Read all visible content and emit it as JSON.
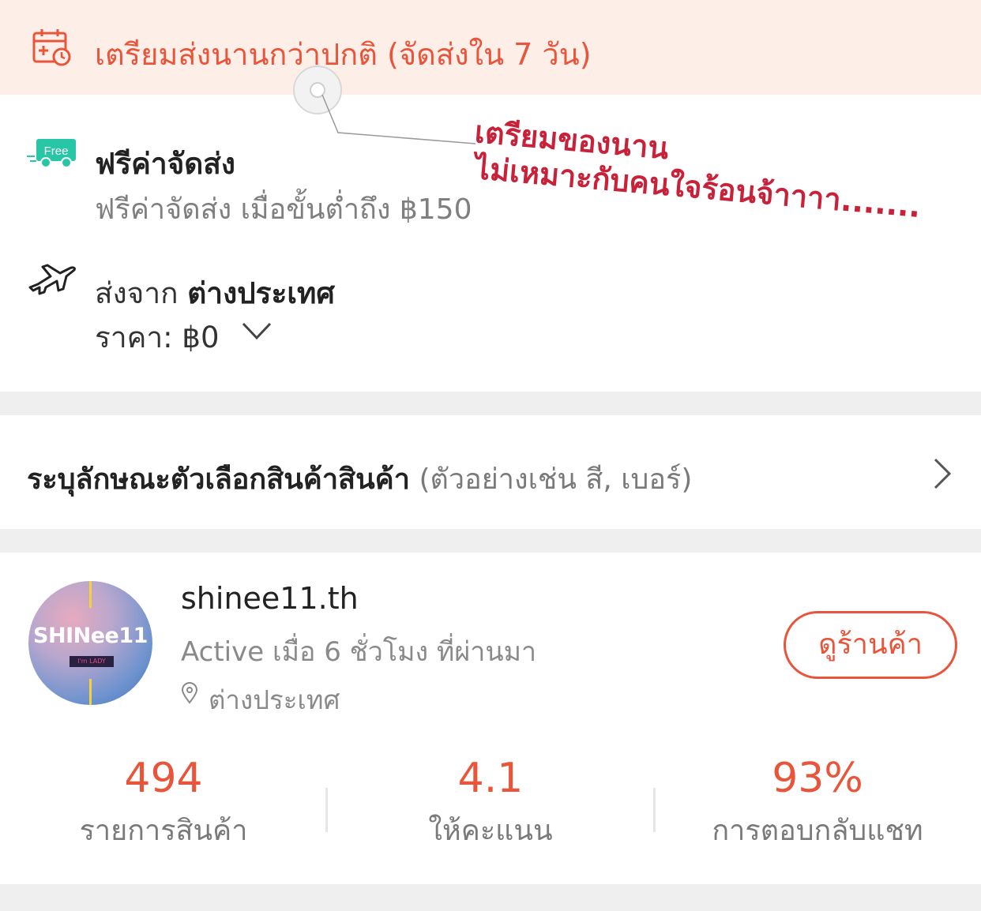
{
  "banner": {
    "text": "เตรียมส่งนานกว่าปกติ (จัดส่งใน 7 วัน)",
    "icon": "calendar-icon"
  },
  "shipping": {
    "free_badge": "Free",
    "free_title": "ฟรีค่าจัดส่ง",
    "free_subtitle": "ฟรีค่าจัดส่ง เมื่อขั้นต่ำถึง ฿150",
    "from_label": "ส่งจาก",
    "from_value": "ต่างประเทศ",
    "price_label": "ราคา: ฿0"
  },
  "annotation": {
    "line1": "เตรียมของนาน",
    "line2": "ไม่เหมาะกับคนใจร้อนจ้าาาา......."
  },
  "variant": {
    "title": "ระบุลักษณะตัวเลือกสินค้าสินค้า",
    "hint": "(ตัวอย่างเช่น สี, เบอร์)"
  },
  "shop": {
    "avatar_text": "SHINee11",
    "avatar_tag": "I'm LADY",
    "name": "shinee11.th",
    "active": "Active เมื่อ 6 ชั่วโมง ที่ผ่านมา",
    "location": "ต่างประเทศ",
    "view_button": "ดูร้านค้า"
  },
  "stats": [
    {
      "value": "494",
      "label": "รายการสินค้า"
    },
    {
      "value": "4.1",
      "label": "ให้คะแนน"
    },
    {
      "value": "93%",
      "label": "การตอบกลับแชท"
    }
  ],
  "colors": {
    "accent": "#e8553a",
    "banner_bg": "#fdeee8",
    "free_green": "#26c6a6",
    "annotation_red": "#c8223a"
  }
}
